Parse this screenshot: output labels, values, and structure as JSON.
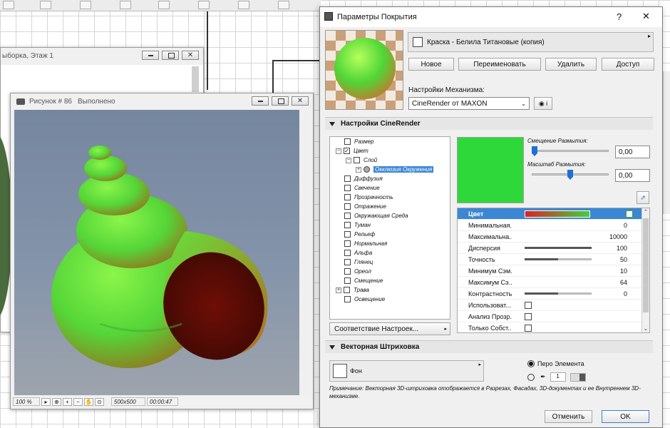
{
  "floorplan_window": {
    "title": "ыборка, Этаж 1"
  },
  "render_window": {
    "title": "Рисунок # 86",
    "status": "Выполнено",
    "zoom": "100 %",
    "size": "500x500",
    "time": "00:00:47"
  },
  "dialog": {
    "title": "Параметры Покрытия",
    "help_label": "?",
    "close_label": "✕",
    "surface_name": "Краска - Белила Титановые (копия)",
    "buttons": {
      "new": "Новое",
      "rename": "Переименовать",
      "delete": "Удалить",
      "access": "Доступ"
    },
    "engine_label": "Настройки Механизма:",
    "engine_value": "CineRender от MAXON",
    "cinerender_header": "Настройки CineRender",
    "tree": [
      {
        "label": "Размер",
        "checked": false,
        "indent": 0
      },
      {
        "label": "Цвет",
        "checked": true,
        "indent": 0
      },
      {
        "label": "Слой",
        "checked": false,
        "indent": 1
      },
      {
        "label": "Окклюзия Окружения",
        "checked": false,
        "indent": 2
      },
      {
        "label": "Диффузия",
        "checked": false,
        "indent": 0
      },
      {
        "label": "Свечение",
        "checked": false,
        "indent": 0
      },
      {
        "label": "Прозрачность",
        "checked": false,
        "indent": 0
      },
      {
        "label": "Отражение",
        "checked": false,
        "indent": 0
      },
      {
        "label": "Окружающая Среда",
        "checked": false,
        "indent": 0
      },
      {
        "label": "Туман",
        "checked": false,
        "indent": 0
      },
      {
        "label": "Рельеф",
        "checked": false,
        "indent": 0
      },
      {
        "label": "Нормальная",
        "checked": false,
        "indent": 0
      },
      {
        "label": "Альфа",
        "checked": false,
        "indent": 0
      },
      {
        "label": "Глянец",
        "checked": false,
        "indent": 0
      },
      {
        "label": "Ореол",
        "checked": false,
        "indent": 0
      },
      {
        "label": "Смещение",
        "checked": false,
        "indent": 0
      },
      {
        "label": "Трава",
        "checked": false,
        "indent": 0
      },
      {
        "label": "Освещение",
        "checked": false,
        "indent": 0
      }
    ],
    "match_settings": "Соответствие Настроек...",
    "blur_offset_label": "Смещение Размытия:",
    "blur_offset_value": "0,00",
    "blur_scale_label": "Масштаб Размытия:",
    "blur_scale_value": "0,00",
    "props": [
      {
        "label": "Цвет",
        "value": "",
        "kind": "gradient"
      },
      {
        "label": "Минимальная...",
        "value": "0",
        "kind": "value"
      },
      {
        "label": "Максимальна...",
        "value": "10000",
        "kind": "value"
      },
      {
        "label": "Дисперсия",
        "value": "100",
        "kind": "bar",
        "fill": 1.0
      },
      {
        "label": "Точность",
        "value": "50",
        "kind": "bar",
        "fill": 0.5
      },
      {
        "label": "Минимум Сэм...",
        "value": "10",
        "kind": "value"
      },
      {
        "label": "Максимум Сэ...",
        "value": "64",
        "kind": "value"
      },
      {
        "label": "Контрастность",
        "value": "0",
        "kind": "bar",
        "fill": 0.5
      },
      {
        "label": "Использоват...",
        "value": "",
        "kind": "check"
      },
      {
        "label": "Анализ Прозр...",
        "value": "",
        "kind": "check"
      },
      {
        "label": "Только Собст...",
        "value": "",
        "kind": "check"
      }
    ],
    "vector_header": "Векторная Штриховка",
    "background_label": "Фон",
    "pen_label": "Перо Элемента",
    "pen_number": "1",
    "note": "Примечание: Векторная 3D-штриховка отображается в Разрезах, Фасадах, 3D-документах и ее Внутреннем 3D-механизме.",
    "cancel": "Отменить",
    "ok": "OK"
  },
  "colors": {
    "swatch": "#2fd83a",
    "highlight": "#3c86d6",
    "accent": "#1e6fd9"
  }
}
